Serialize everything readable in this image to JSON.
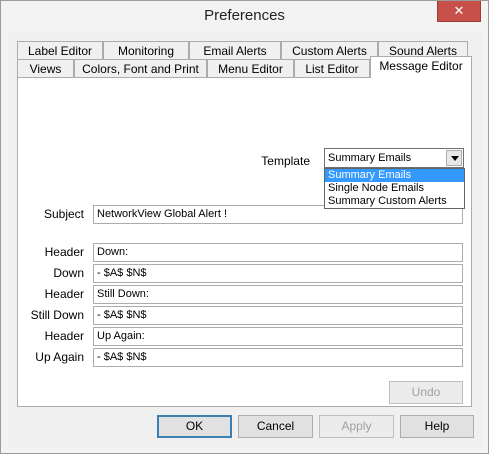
{
  "window": {
    "title": "Preferences",
    "close_label": "✕"
  },
  "tabs_row1": [
    {
      "label": "Label Editor"
    },
    {
      "label": "Monitoring"
    },
    {
      "label": "Email Alerts"
    },
    {
      "label": "Custom Alerts"
    },
    {
      "label": "Sound Alerts"
    }
  ],
  "tabs_row2": [
    {
      "label": "Views"
    },
    {
      "label": "Colors, Font and Print"
    },
    {
      "label": "Menu Editor"
    },
    {
      "label": "List Editor"
    },
    {
      "label": "Message Editor",
      "active": true
    }
  ],
  "template": {
    "label": "Template",
    "value": "Summary Emails",
    "options": [
      "Summary Emails",
      "Single Node Emails",
      "Summary Custom Alerts"
    ],
    "selected_index": 0
  },
  "fields": {
    "subject": {
      "label": "Subject",
      "value": "NetworkView Global Alert !"
    },
    "header1": {
      "label": "Header",
      "value": "Down:"
    },
    "down": {
      "label": "Down",
      "value": "- $A$ $N$"
    },
    "header2": {
      "label": "Header",
      "value": "Still Down:"
    },
    "still_down": {
      "label": "Still Down",
      "value": "- $A$ $N$"
    },
    "header3": {
      "label": "Header",
      "value": "Up Again:"
    },
    "up_again": {
      "label": "Up Again",
      "value": "- $A$ $N$"
    }
  },
  "buttons": {
    "undo": "Undo",
    "ok": "OK",
    "cancel": "Cancel",
    "apply": "Apply",
    "help": "Help"
  }
}
